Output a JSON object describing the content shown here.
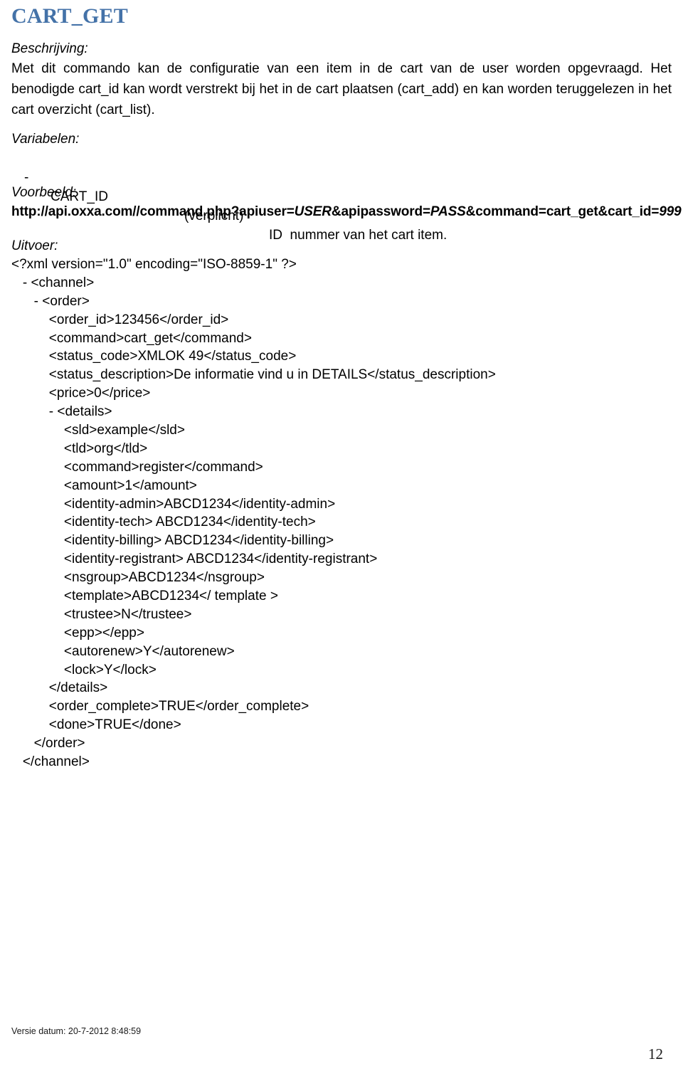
{
  "document": {
    "title": "CART_GET"
  },
  "sections": {
    "description": {
      "label": "Beschrijving:",
      "text": "Met dit commando kan de configuratie van een item in de cart van de user worden opgevraagd. Het benodigde cart_id kan wordt verstrekt bij het in de cart plaatsen (cart_add) en kan worden teruggelezen in het cart overzicht (cart_list)."
    },
    "variables": {
      "label": "Variabelen:",
      "rows": [
        {
          "dash": "-",
          "name": "CART_ID",
          "required": "(verplicht)",
          "description": "ID  nummer van het cart item."
        }
      ]
    },
    "example": {
      "label": "Voorbeeld:",
      "url_parts": [
        {
          "text": "http://api.oxxa.com//command.php?apiuser=",
          "italic": false
        },
        {
          "text": "USER",
          "italic": true
        },
        {
          "text": "&apipassword=",
          "italic": false
        },
        {
          "text": "PASS",
          "italic": true
        },
        {
          "text": "&command=cart_get&cart_id=",
          "italic": false
        },
        {
          "text": "999",
          "italic": true
        }
      ]
    },
    "output": {
      "label": "Uitvoer:",
      "xml_lines": [
        "<?xml version=\"1.0\" encoding=\"ISO-8859-1\" ?>",
        "   - <channel>",
        "      - <order>",
        "          <order_id>123456</order_id>",
        "          <command>cart_get</command>",
        "          <status_code>XMLOK 49</status_code>",
        "          <status_description>De informatie vind u in DETAILS</status_description>",
        "          <price>0</price>",
        "          - <details>",
        "              <sld>example</sld>",
        "              <tld>org</tld>",
        "              <command>register</command>",
        "              <amount>1</amount>",
        "              <identity-admin>ABCD1234</identity-admin>",
        "              <identity-tech> ABCD1234</identity-tech>",
        "              <identity-billing> ABCD1234</identity-billing>",
        "              <identity-registrant> ABCD1234</identity-registrant>",
        "              <nsgroup>ABCD1234</nsgroup>",
        "              <template>ABCD1234</ template >",
        "              <trustee>N</trustee>",
        "              <epp></epp>",
        "              <autorenew>Y</autorenew>",
        "              <lock>Y</lock>",
        "          </details>",
        "          <order_complete>TRUE</order_complete>",
        "          <done>TRUE</done>",
        "      </order>",
        "   </channel>"
      ]
    }
  },
  "footer": {
    "version_text": "Versie datum: 20-7-2012 8:48:59",
    "page_number": "12"
  },
  "colors": {
    "title": "#4472A8",
    "body_text": "#000000",
    "page_background": "#ffffff"
  }
}
